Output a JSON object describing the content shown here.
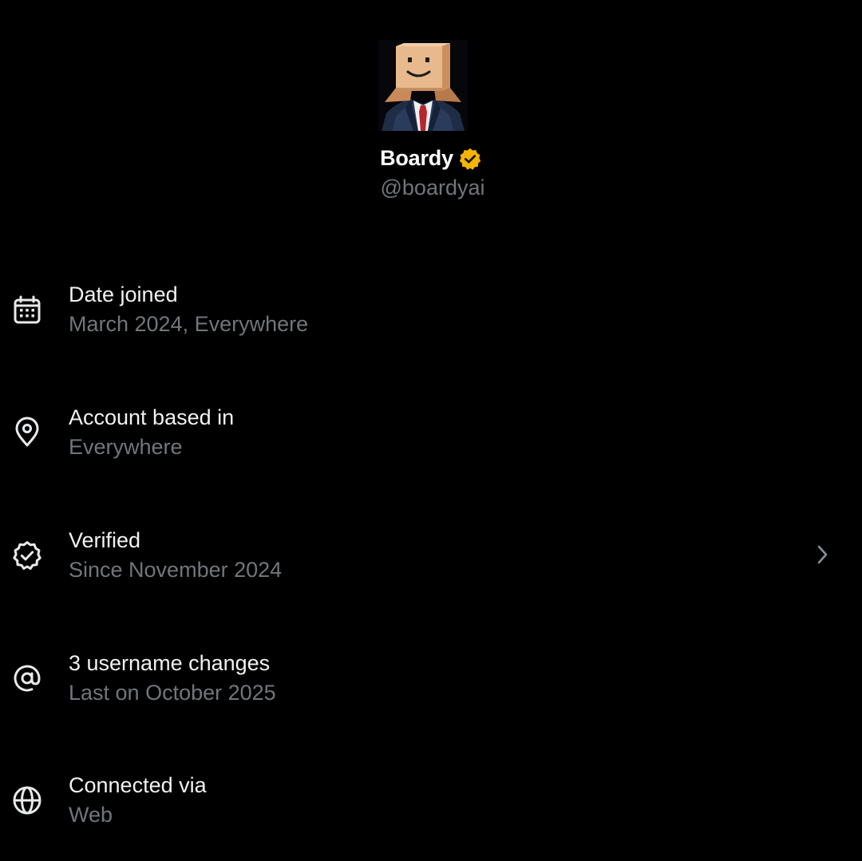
{
  "profile": {
    "display_name": "Boardy",
    "handle": "@boardyai",
    "avatar_icon": "box-head-businessman-avatar",
    "badge_icon": "verified-badge-icon",
    "badge_color": "#f4b400"
  },
  "about": {
    "items": [
      {
        "icon": "calendar-icon",
        "title": "Date joined",
        "subtitle": "March 2024, Everywhere",
        "has_chevron": false
      },
      {
        "icon": "location-pin-icon",
        "title": "Account based in",
        "subtitle": "Everywhere",
        "has_chevron": false
      },
      {
        "icon": "verified-icon",
        "title": "Verified",
        "subtitle": "Since November 2024",
        "has_chevron": true
      },
      {
        "icon": "at-sign-icon",
        "title": "3 username changes",
        "subtitle": "Last on October 2025",
        "has_chevron": false
      },
      {
        "icon": "globe-icon",
        "title": "Connected via",
        "subtitle": "Web",
        "has_chevron": false
      }
    ]
  },
  "colors": {
    "background": "#000000",
    "primary_text": "#e7e9ea",
    "secondary_text": "#71767b"
  }
}
